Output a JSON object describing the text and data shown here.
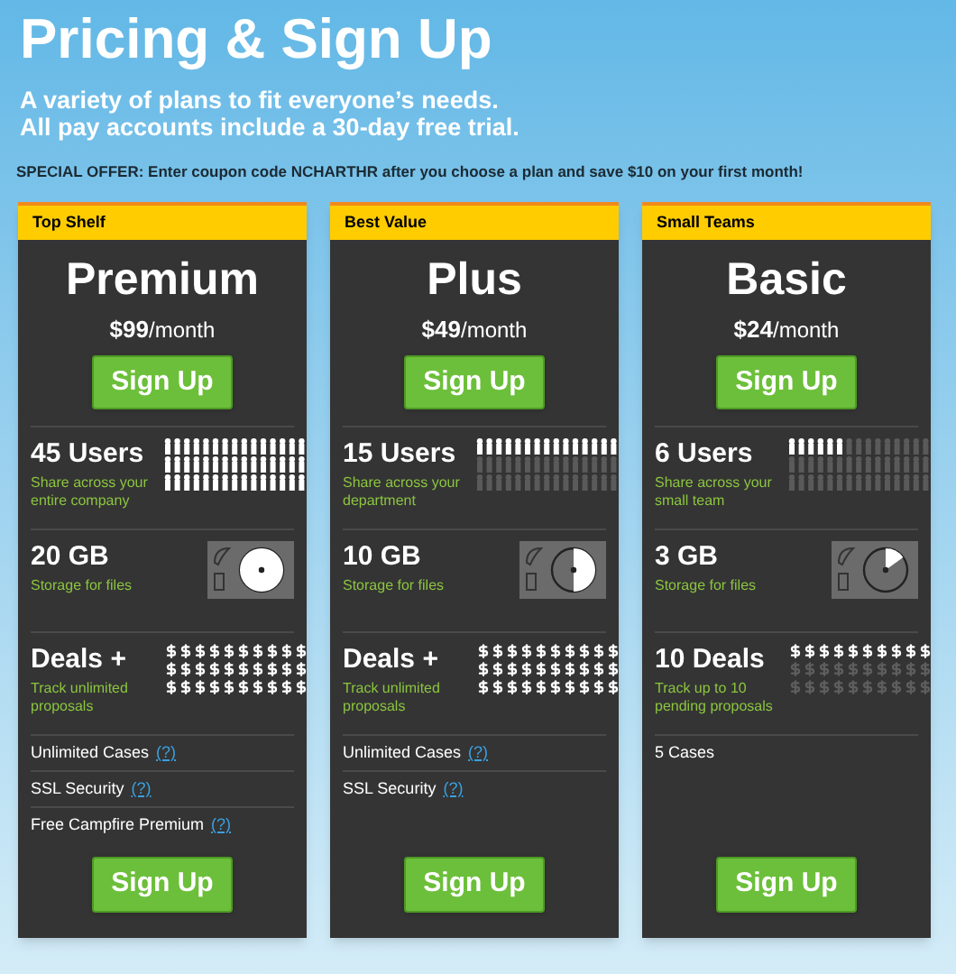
{
  "title": "Pricing & Sign Up",
  "subtitle": [
    "A variety of plans to fit everyone’s needs.",
    "All pay accounts include a 30-day free trial."
  ],
  "offer": "SPECIAL OFFER: Enter coupon code NCHARTHR after you choose a plan and save $10 on your first month!",
  "plans": [
    {
      "tag": "Top Shelf",
      "name": "Premium",
      "price": "$99",
      "per": "/month",
      "signup": "Sign Up",
      "users": {
        "title": "45 Users",
        "desc": "Share across your entire company"
      },
      "storage": {
        "title": "20 GB",
        "desc": "Storage for files"
      },
      "deals": {
        "title": "Deals +",
        "desc": "Track unlimited proposals"
      },
      "features": [
        {
          "label": "Unlimited Cases",
          "help": "(?)"
        },
        {
          "label": "SSL Security",
          "help": "(?)"
        },
        {
          "label": "Free Campfire Premium",
          "help": "(?)"
        }
      ],
      "bottom_signup": "Sign Up"
    },
    {
      "tag": "Best Value",
      "name": "Plus",
      "price": "$49",
      "per": "/month",
      "signup": "Sign Up",
      "users": {
        "title": "15 Users",
        "desc": "Share across your department"
      },
      "storage": {
        "title": "10 GB",
        "desc": "Storage for files"
      },
      "deals": {
        "title": "Deals +",
        "desc": "Track unlimited proposals"
      },
      "features": [
        {
          "label": "Unlimited Cases",
          "help": "(?)"
        },
        {
          "label": "SSL Security",
          "help": "(?)"
        }
      ],
      "bottom_signup": "Sign Up"
    },
    {
      "tag": "Small Teams",
      "name": "Basic",
      "price": "$24",
      "per": "/month",
      "signup": "Sign Up",
      "users": {
        "title": "6 Users",
        "desc": "Share across your small team"
      },
      "storage": {
        "title": "3 GB",
        "desc": "Storage for files"
      },
      "deals": {
        "title": "10 Deals",
        "desc": "Track up to 10 pending proposals"
      },
      "features": [
        {
          "label": "5 Cases"
        }
      ],
      "bottom_signup": "Sign Up"
    }
  ]
}
